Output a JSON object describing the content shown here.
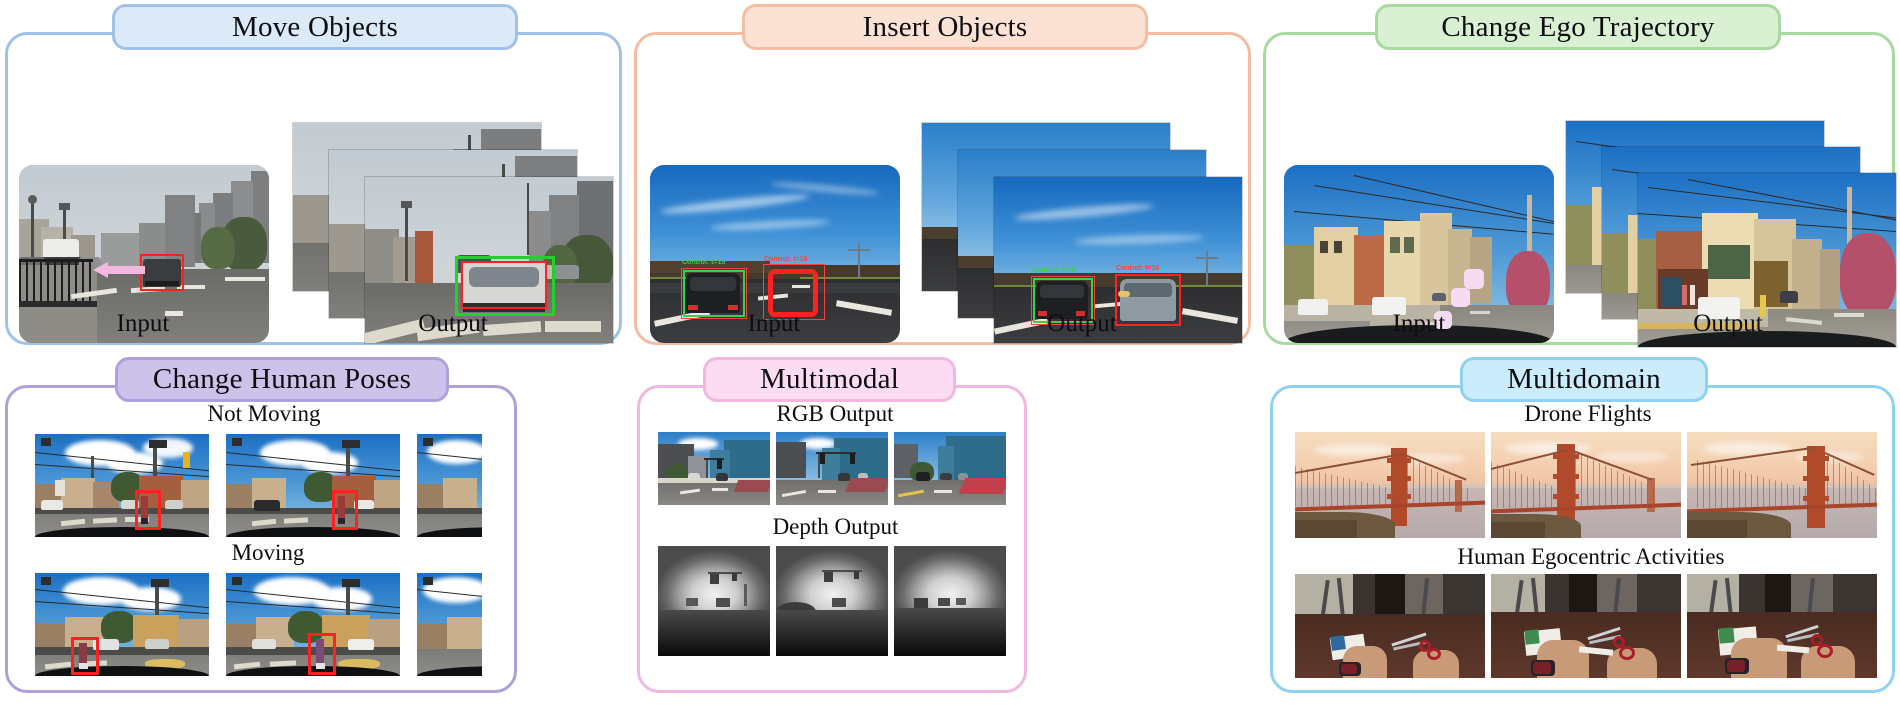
{
  "panels": [
    {
      "id": "move-objects",
      "title": "Move Objects",
      "accent": "#9fc3e8",
      "badge_fill": "#dce9f7",
      "captions": {
        "input": "Input",
        "output": "Output"
      }
    },
    {
      "id": "insert-objects",
      "title": "Insert Objects",
      "accent": "#f2bda0",
      "badge_fill": "#fbe2d4",
      "captions": {
        "input": "Input",
        "output": "Output"
      },
      "annotations": [
        {
          "text": "Control: t=15",
          "color": "#39d14a"
        },
        {
          "text": "Control: t=16",
          "color": "#ff4040"
        }
      ]
    },
    {
      "id": "change-ego-trajectory",
      "title": "Change Ego Trajectory",
      "accent": "#a8d9a0",
      "badge_fill": "#d9f0d2",
      "captions": {
        "input": "Input",
        "output": "Output"
      }
    },
    {
      "id": "change-human-poses",
      "title": "Change Human Poses",
      "accent": "#b0a0da",
      "badge_fill": "#cdc2ea",
      "rows": [
        {
          "label": "Not Moving"
        },
        {
          "label": "Moving"
        }
      ]
    },
    {
      "id": "multimodal",
      "title": "Multimodal",
      "accent": "#f0b8e0",
      "badge_fill": "#fbdcf2",
      "rows": [
        {
          "label": "RGB Output"
        },
        {
          "label": "Depth Output"
        }
      ]
    },
    {
      "id": "multidomain",
      "title": "Multidomain",
      "accent": "#8fd2ef",
      "badge_fill": "#cbecfa",
      "rows": [
        {
          "label": "Drone Flights"
        },
        {
          "label": "Human Egocentric Activities"
        }
      ]
    }
  ],
  "colors": {
    "bbox_red": "#ff2020",
    "bbox_green": "#22d12a",
    "arrow_pink": "#f2b8df",
    "control_chip": "#f6dcf3"
  }
}
